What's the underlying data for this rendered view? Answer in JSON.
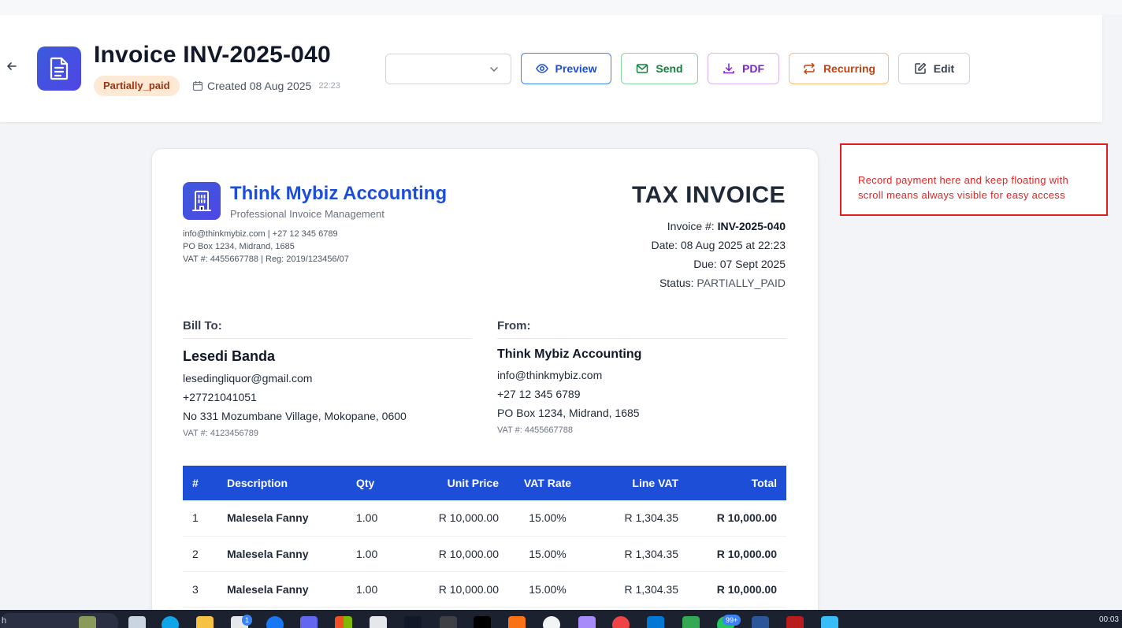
{
  "header": {
    "back_icon": "arrow-left-icon",
    "doc_icon": "file-text-icon",
    "title": "Invoice INV-2025-040",
    "status_badge": "Partially_paid",
    "created_label": "Created 08 Aug 2025",
    "created_time": "22:23",
    "template_select_value": "",
    "buttons": {
      "preview": "Preview",
      "send": "Send",
      "pdf": "PDF",
      "recurring": "Recurring",
      "edit": "Edit"
    }
  },
  "company": {
    "name": "Think Mybiz Accounting",
    "tagline": "Professional Invoice Management",
    "contact": "info@thinkmybiz.com | +27 12 345 6789",
    "address": "PO Box 1234, Midrand, 1685",
    "vat_reg": "VAT #: 4455667788 | Reg: 2019/123456/07"
  },
  "invoice": {
    "heading": "TAX INVOICE",
    "number_label": "Invoice #:",
    "number": "INV-2025-040",
    "date": "Date: 08 Aug 2025 at 22:23",
    "due": "Due: 07 Sept 2025",
    "status_label": "Status:",
    "status": "PARTIALLY_PAID"
  },
  "bill_to": {
    "label": "Bill To:",
    "name": "Lesedi Banda",
    "email": "lesedingliquor@gmail.com",
    "phone": "+27721041051",
    "address": "No 331 Mozumbane Village, Mokopane, 0600",
    "vat": "VAT #: 4123456789"
  },
  "from": {
    "label": "From:",
    "name": "Think Mybiz Accounting",
    "email": "info@thinkmybiz.com",
    "phone": "+27 12 345 6789",
    "address": "PO Box 1234, Midrand, 1685",
    "vat": "VAT #: 4455667788"
  },
  "table": {
    "headers": [
      "#",
      "Description",
      "Qty",
      "Unit Price",
      "VAT Rate",
      "Line VAT",
      "Total"
    ],
    "rows": [
      [
        "1",
        "Malesela Fanny",
        "1.00",
        "R 10,000.00",
        "15.00%",
        "R 1,304.35",
        "R 10,000.00"
      ],
      [
        "2",
        "Malesela Fanny",
        "1.00",
        "R 10,000.00",
        "15.00%",
        "R 1,304.35",
        "R 10,000.00"
      ],
      [
        "3",
        "Malesela Fanny",
        "1.00",
        "R 10,000.00",
        "15.00%",
        "R 1,304.35",
        "R 10,000.00"
      ]
    ]
  },
  "annotation": {
    "text": "Record payment here and keep floating with scroll means always visible for easy access",
    "color": "#e11d1d"
  },
  "taskbar": {
    "search_text": "h",
    "clock": "00:03",
    "badges": [
      "1",
      "99+"
    ]
  },
  "colors": {
    "brand_blue": "#1d4ed8",
    "badge_bg": "#fde9d4",
    "badge_text": "#9a3412"
  }
}
